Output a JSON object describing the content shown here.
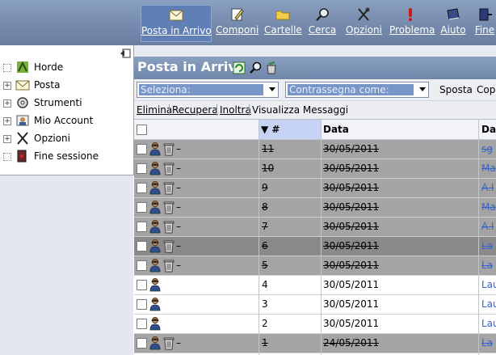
{
  "toolbar": {
    "items": [
      {
        "label": "Posta in Arrivo",
        "icon": "envelope-icon"
      },
      {
        "label": "Componi",
        "icon": "compose-icon"
      },
      {
        "label": "Cartelle",
        "icon": "folder-icon"
      },
      {
        "label": "Cerca",
        "icon": "magnifier-icon"
      },
      {
        "label": "Opzioni",
        "icon": "tools-icon"
      },
      {
        "label": "Problema",
        "icon": "exclamation-icon"
      },
      {
        "label": "Aiuto",
        "icon": "book-icon"
      },
      {
        "label": "Fine",
        "icon": "exit-icon"
      }
    ]
  },
  "sidebar": {
    "items": [
      {
        "label": "Horde"
      },
      {
        "label": "Posta"
      },
      {
        "label": "Strumenti"
      },
      {
        "label": "Mio Account"
      },
      {
        "label": "Opzioni"
      },
      {
        "label": "Fine sessione"
      }
    ]
  },
  "main": {
    "title": "Posta in Arrivo",
    "select_placeholder": "Seleziona:",
    "mark_placeholder": "Contrassegna come:",
    "move_label": "Sposta",
    "copy_label": "Copi",
    "actions": {
      "delete": "Elimina",
      "recover": "Recupera",
      "forward": "Inoltra",
      "view": "Visualizza Messaggi"
    },
    "columns": {
      "sort_arrow": "▼",
      "number": "#",
      "date": "Data",
      "from": "Da"
    },
    "rows": [
      {
        "num": "11",
        "date": "30/05/2011",
        "from": "sg",
        "deleted": true
      },
      {
        "num": "10",
        "date": "30/05/2011",
        "from": "Ma",
        "deleted": true
      },
      {
        "num": "9",
        "date": "30/05/2011",
        "from": "A.I",
        "deleted": true
      },
      {
        "num": "8",
        "date": "30/05/2011",
        "from": "Ma",
        "deleted": true
      },
      {
        "num": "7",
        "date": "30/05/2011",
        "from": "A.I",
        "deleted": true
      },
      {
        "num": "6",
        "date": "30/05/2011",
        "from": "La",
        "deleted": true
      },
      {
        "num": "5",
        "date": "30/05/2011",
        "from": "La",
        "deleted": true
      },
      {
        "num": "4",
        "date": "30/05/2011",
        "from": "Lau",
        "deleted": false
      },
      {
        "num": "3",
        "date": "30/05/2011",
        "from": "Lau",
        "deleted": false
      },
      {
        "num": "2",
        "date": "30/05/2011",
        "from": "Lau",
        "deleted": false
      },
      {
        "num": "1",
        "date": "24/05/2011",
        "from": "La",
        "deleted": true
      }
    ],
    "dash": "–"
  },
  "colors": {
    "toolbar_bg": "#7489ab",
    "deleted_row": "#a4a4a4",
    "sender_link": "#3a63c8"
  }
}
